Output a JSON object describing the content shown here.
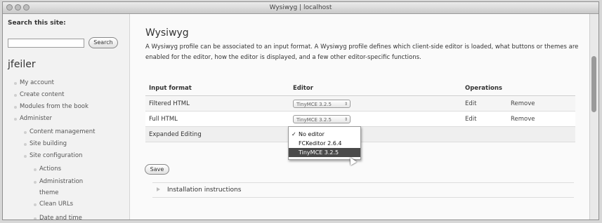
{
  "window": {
    "title": "Wysiwyg | localhost"
  },
  "sidebar": {
    "search_label": "Search this site:",
    "search_value": "",
    "search_button": "Search",
    "username": "jfeiler",
    "items": [
      {
        "label": "My account"
      },
      {
        "label": "Create content"
      },
      {
        "label": "Modules from the book"
      },
      {
        "label": "Administer"
      },
      {
        "label": "Content management"
      },
      {
        "label": "Site building"
      },
      {
        "label": "Site configuration"
      },
      {
        "label": "Actions"
      },
      {
        "label": "Administration"
      },
      {
        "label": "theme"
      },
      {
        "label": "Clean URLs"
      },
      {
        "label": "Date and time"
      }
    ]
  },
  "main": {
    "title": "Wysiwyg",
    "description": "A Wysiwyg profile can be associated to an input format. A Wysiwyg profile defines which client-side editor is loaded, what buttons or themes are enabled for the editor, how the editor is displayed, and a few other editor-specific functions.",
    "columns": [
      "Input format",
      "Editor",
      "Operations"
    ],
    "rows": [
      {
        "format": "Filtered HTML",
        "editor": "TinyMCE 3.2.5",
        "edit": "Edit",
        "remove": "Remove"
      },
      {
        "format": "Full HTML",
        "editor": "TinyMCE 3.2.5",
        "edit": "Edit",
        "remove": "Remove"
      },
      {
        "format": "Expanded Editing",
        "editor": "",
        "edit": "",
        "remove": ""
      }
    ],
    "dropdown": {
      "options": [
        "No editor",
        "FCKeditor 2.6.4",
        "TinyMCE 3.2.5"
      ],
      "checked": "No editor",
      "highlighted": "TinyMCE 3.2.5"
    },
    "save_button": "Save",
    "installation": "Installation instructions"
  }
}
